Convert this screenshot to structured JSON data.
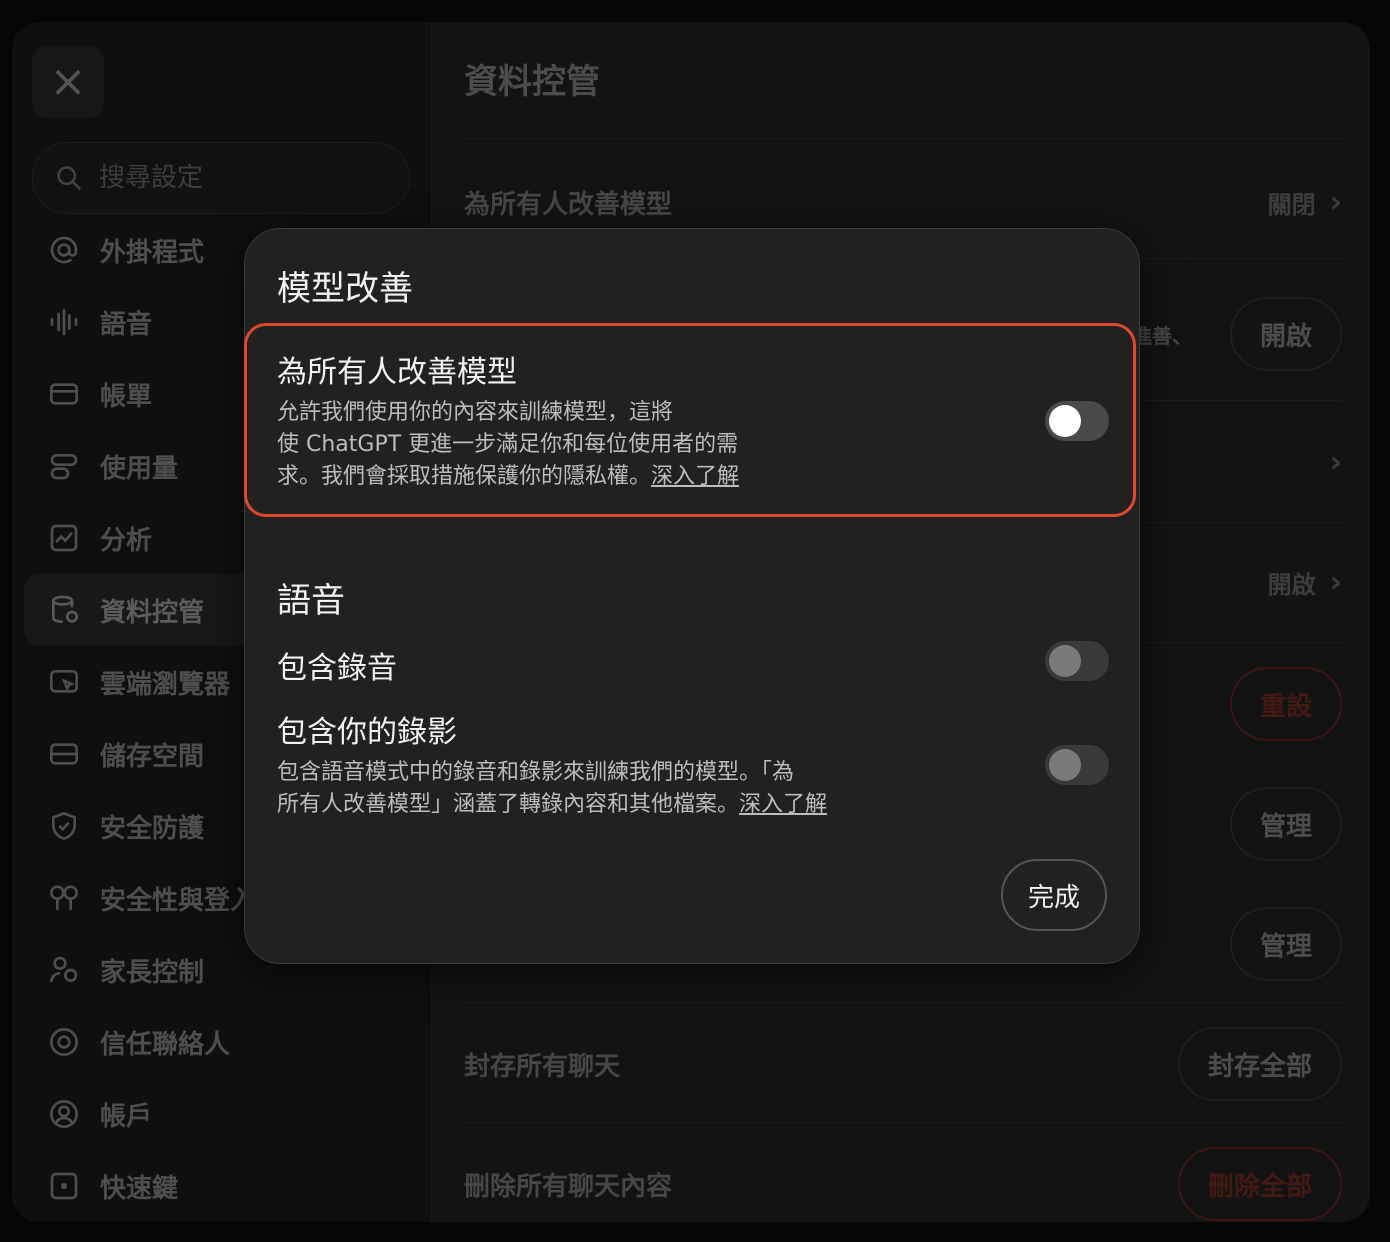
{
  "background": {
    "close_label": "×",
    "search": {
      "placeholder": "搜尋設定"
    },
    "sidebar": {
      "items": [
        {
          "label": "外掛程式",
          "icon": "at-icon"
        },
        {
          "label": "語音",
          "icon": "waveform-icon"
        },
        {
          "label": "帳單",
          "icon": "credit-card-icon"
        },
        {
          "label": "使用量",
          "icon": "usage-icon"
        },
        {
          "label": "分析",
          "icon": "chart-icon"
        },
        {
          "label": "資料控管",
          "icon": "database-icon",
          "active": true
        },
        {
          "label": "雲端瀏覽器",
          "icon": "cloud-browser-icon"
        },
        {
          "label": "儲存空間",
          "icon": "storage-icon"
        },
        {
          "label": "安全防護",
          "icon": "shield-icon"
        },
        {
          "label": "安全性與登入",
          "icon": "key-icon"
        },
        {
          "label": "家長控制",
          "icon": "parental-control-icon"
        },
        {
          "label": "信任聯絡人",
          "icon": "lifebuoy-icon"
        },
        {
          "label": "帳戶",
          "icon": "account-icon"
        },
        {
          "label": "快速鍵",
          "icon": "keyboard-icon"
        }
      ]
    },
    "content": {
      "title": "資料控管",
      "improve_model_label": "為所有人改善模型",
      "improve_model_value": "關閉",
      "open_label_1": "開啟",
      "open_value_2": "開啟",
      "reset_label": "重設",
      "manage_label_1": "管理",
      "manage_label_2": "管理",
      "archive_label": "封存所有聊天",
      "archive_button": "封存全部",
      "delete_label": "刪除所有聊天內容",
      "delete_button": "刪除全部",
      "partial_text": "進善、"
    }
  },
  "modal": {
    "title": "模型改善",
    "improve": {
      "title": "為所有人改善模型",
      "desc_line1": "允許我們使用你的內容來訓練模型，這將",
      "desc_line2": "使 ChatGPT 更進一步滿足你和每位使用者的需",
      "desc_line3": "求。我們會採取措施保護你的隱私權。",
      "learn_more": "深入了解",
      "enabled": false
    },
    "voice_section_title": "語音",
    "include_audio": {
      "title": "包含錄音",
      "enabled": false
    },
    "include_video": {
      "title": "包含你的錄影",
      "desc_line1": "包含語音模式中的錄音和錄影來訓練我們的模型。「為",
      "desc_line2": "所有人改善模型」涵蓋了轉錄內容和其他檔案。",
      "learn_more": "深入了解",
      "enabled": false
    },
    "done_label": "完成",
    "highlight_color": "#e0492f"
  }
}
